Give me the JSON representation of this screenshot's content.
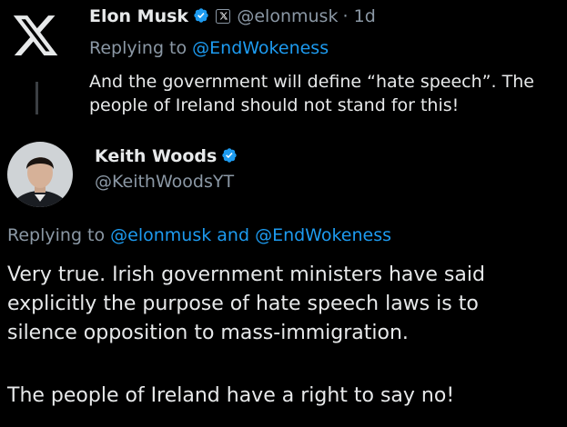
{
  "tweet1": {
    "author_name": "Elon Musk",
    "author_handle": "@elonmusk",
    "time": "· 1d",
    "reply_prefix": "Replying to ",
    "reply_mention": "@EndWokeness",
    "text_line1": "And the government will define “hate speech”. The",
    "text_line2": "people of Ireland should not stand for this!"
  },
  "tweet2": {
    "author_name": "Keith Woods",
    "author_handle": "@KeithWoodsYT",
    "reply_prefix": "Replying to ",
    "reply_mention1": "@elonmusk",
    "reply_and": " and ",
    "reply_mention2": "@EndWokeness",
    "text_line1": "Very true. Irish government ministers have said",
    "text_line2": "explicitly the purpose of hate speech laws is to",
    "text_line3": "silence opposition to mass-immigration.",
    "text_line4": "The people of Ireland have a right to say no!"
  },
  "colors": {
    "background": "#000000",
    "text": "#e7e9ea",
    "muted": "#8b98a5",
    "link": "#1d9bf0",
    "verified": "#1d9bf0"
  },
  "icons": [
    "x-logo-icon",
    "verified-badge-icon",
    "x-affiliation-icon",
    "avatar"
  ]
}
